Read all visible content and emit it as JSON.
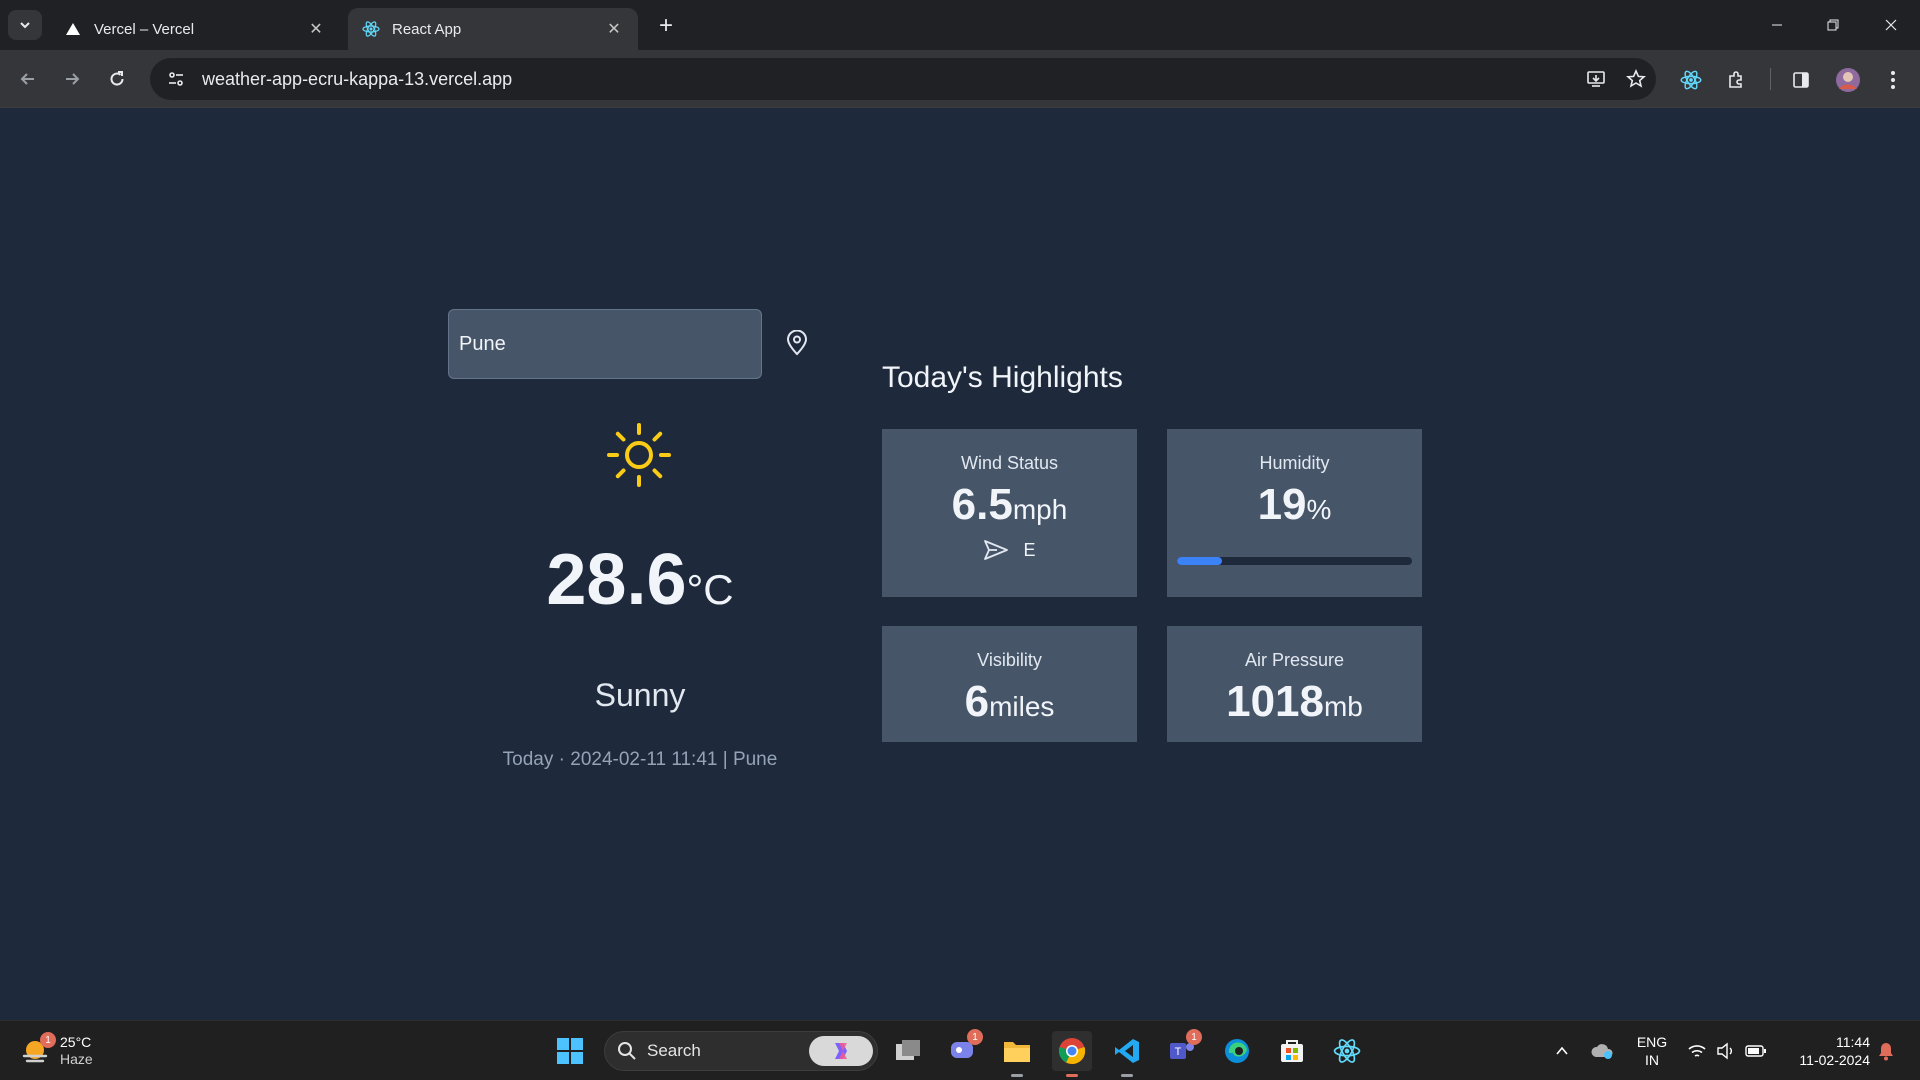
{
  "browser": {
    "tabs": [
      {
        "title": "Vercel – Vercel",
        "favicon": "vercel-triangle-icon",
        "active": false
      },
      {
        "title": "React App",
        "favicon": "react-icon",
        "active": true
      }
    ],
    "url": "weather-app-ecru-kappa-13.vercel.app"
  },
  "weather": {
    "search_value": "Pune",
    "condition_icon": "sun-icon",
    "temperature": "28.6",
    "temperature_unit": "°C",
    "condition": "Sunny",
    "date_line": "Today · 2024-02-11 11:41 | Pune"
  },
  "highlights": {
    "title": "Today's Highlights",
    "wind": {
      "label": "Wind Status",
      "value": "6.5",
      "unit": "mph",
      "direction": "E"
    },
    "humidity": {
      "label": "Humidity",
      "value": "19",
      "unit": "%",
      "percent": 19
    },
    "visibility": {
      "label": "Visibility",
      "value": "6",
      "unit": "miles"
    },
    "pressure": {
      "label": "Air Pressure",
      "value": "1018",
      "unit": "mb"
    }
  },
  "taskbar": {
    "weather_temp": "25°C",
    "weather_desc": "Haze",
    "weather_badge": "1",
    "search_label": "Search",
    "teams_badge": "1",
    "chat_badge": "1",
    "language_line1": "ENG",
    "language_line2": "IN",
    "time": "11:44",
    "date": "11-02-2024"
  },
  "colors": {
    "page_bg": "#1e293b",
    "card_bg": "#475569",
    "accent": "#3b82f6",
    "sun": "#facc15"
  }
}
